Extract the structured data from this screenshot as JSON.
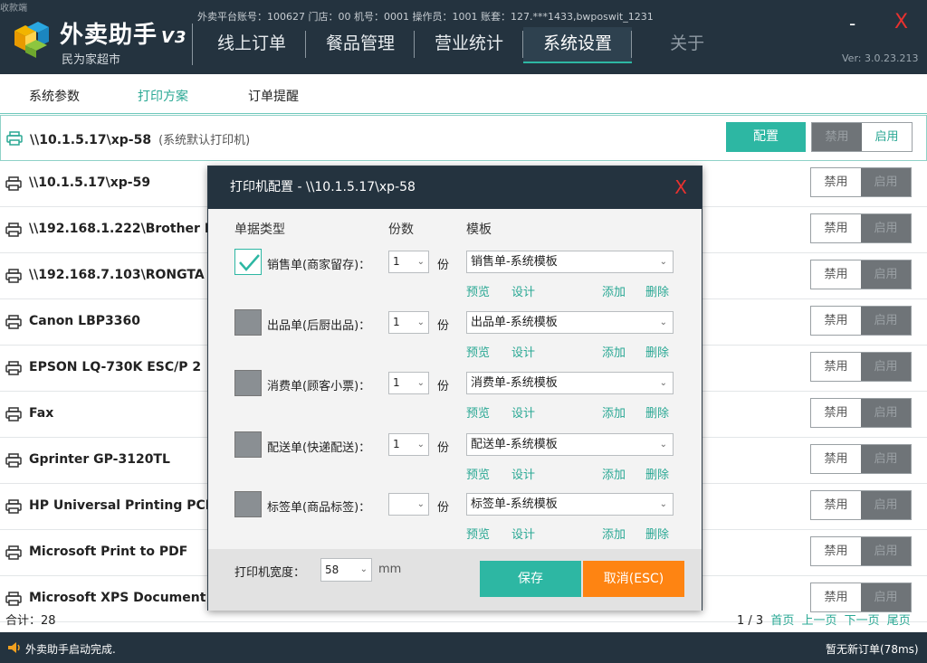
{
  "header": {
    "top_edge": "收款端",
    "brand": "外卖助手",
    "brand_version": "V3",
    "slogan": "民为家超市",
    "info": "外卖平台账号：100627 门店：00 机号：0001 操作员：1001 账套：127.***1433,bwposwit_1231",
    "nav": [
      "线上订单",
      "餐品管理",
      "营业统计",
      "系统设置",
      "关于"
    ],
    "minimize": "-",
    "close": "X",
    "version": "Ver: 3.0.23.213"
  },
  "subtabs": [
    "系统参数",
    "打印方案",
    "订单提醒"
  ],
  "printers": [
    {
      "name": "\\\\10.1.5.17\\xp-58",
      "note": "(系统默认打印机)",
      "enabled": true,
      "config": "配置"
    },
    {
      "name": "\\\\10.1.5.17\\xp-59",
      "note": "",
      "enabled": false
    },
    {
      "name": "\\\\192.168.1.222\\Brother M",
      "note": "",
      "enabled": false
    },
    {
      "name": "\\\\192.168.7.103\\RONGTA",
      "note": "",
      "enabled": false
    },
    {
      "name": "Canon LBP3360",
      "note": "",
      "enabled": false
    },
    {
      "name": "EPSON LQ-730K ESC/P 2",
      "note": "",
      "enabled": false
    },
    {
      "name": "Fax",
      "note": "",
      "enabled": false
    },
    {
      "name": "Gprinter GP-3120TL",
      "note": "",
      "enabled": false
    },
    {
      "name": "HP Universal Printing PCL",
      "note": "",
      "enabled": false
    },
    {
      "name": "Microsoft Print to PDF",
      "note": "",
      "enabled": false
    },
    {
      "name": "Microsoft XPS Document",
      "note": "",
      "enabled": false
    }
  ],
  "toggle": {
    "disable": "禁用",
    "enable": "启用"
  },
  "footer": {
    "total_label": "合计：",
    "total": "28",
    "page": "1 / 3",
    "first": "首页",
    "prev": "上一页",
    "next": "下一页",
    "last": "尾页"
  },
  "status": {
    "left": "外卖助手启动完成.",
    "right": "暂无新订单(78ms)"
  },
  "modal": {
    "title": "打印机配置 - \\\\10.1.5.17\\xp-58",
    "close": "X",
    "col_type": "单据类型",
    "col_qty": "份数",
    "col_template": "模板",
    "unit": "份",
    "rows": [
      {
        "label": "销售单(商家留存)：",
        "checked": true,
        "qty": "1",
        "template": "销售单-系统模板"
      },
      {
        "label": "出品单(后厨出品)：",
        "checked": false,
        "qty": "1",
        "template": "出品单-系统模板"
      },
      {
        "label": "消费单(顾客小票)：",
        "checked": false,
        "qty": "1",
        "template": "消费单-系统模板"
      },
      {
        "label": "配送单(快递配送)：",
        "checked": false,
        "qty": "1",
        "template": "配送单-系统模板"
      },
      {
        "label": "标签单(商品标签)：",
        "checked": false,
        "qty": "",
        "template": "标签单-系统模板"
      }
    ],
    "links": {
      "preview": "预览",
      "design": "设计",
      "add": "添加",
      "delete": "删除"
    },
    "width_label": "打印机宽度：",
    "width": "58",
    "width_unit": "mm",
    "save": "保存",
    "cancel": "取消(ESC)"
  },
  "colors": {
    "accent": "#2db7a3",
    "header": "#24333f",
    "cancel": "#fe8412",
    "close": "#e8312f"
  }
}
